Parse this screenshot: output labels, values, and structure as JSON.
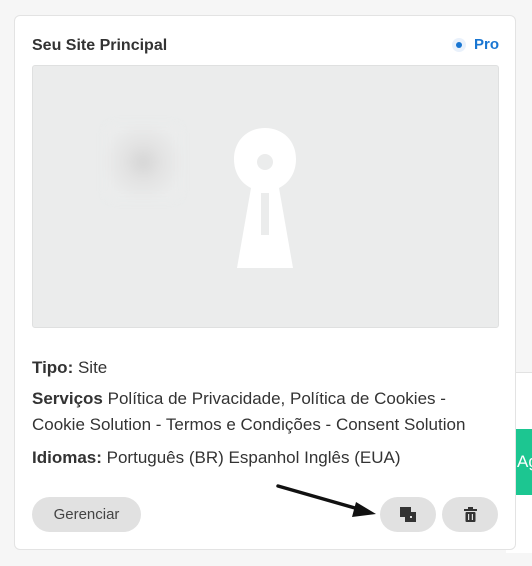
{
  "site_card": {
    "title": "Seu Site Principal",
    "plan": "Pro",
    "details": {
      "tipo_label": "Tipo:",
      "tipo_value": "Site",
      "servicos_label": "Serviços",
      "servicos_value": "Política de Privacidade, Política de Cookies - Cookie Solution - Termos e Condições - Consent Solution",
      "idiomas_label": "Idiomas:",
      "idiomas_value": "Português (BR) Espanhol Inglês (EUA)"
    },
    "actions": {
      "manage_label": "Gerenciar",
      "duplicate_icon": "duplicate-icon",
      "delete_icon": "trash-icon"
    }
  },
  "add_button_peek": {
    "label": "Ag"
  },
  "colors": {
    "plan_accent": "#1976d2",
    "add_button": "#1cc691",
    "button_bg": "#e1e1e1",
    "text": "#333333"
  }
}
